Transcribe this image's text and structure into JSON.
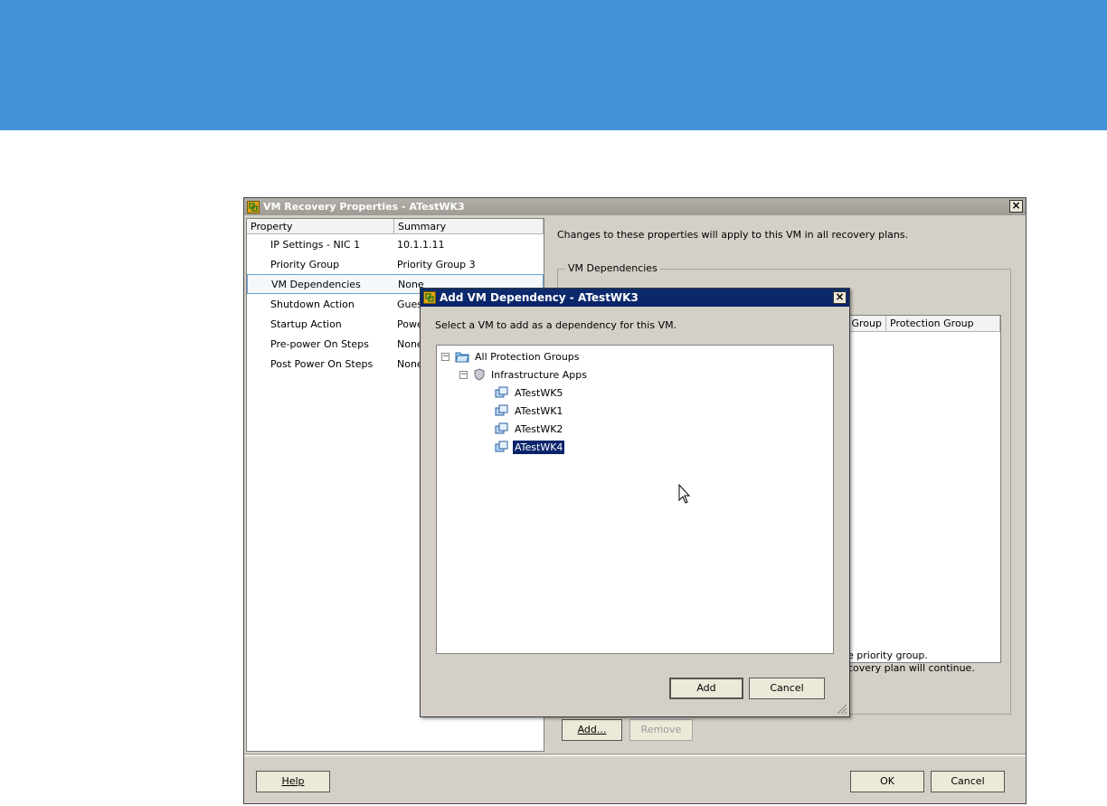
{
  "main_window": {
    "title": "VM Recovery Properties - ATestWK3",
    "columns": {
      "property": "Property",
      "summary": "Summary"
    },
    "properties": [
      {
        "name": "IP Settings - NIC 1",
        "summary": "10.1.1.11"
      },
      {
        "name": "Priority Group",
        "summary": "Priority Group 3"
      },
      {
        "name": "VM Dependencies",
        "summary": "None"
      },
      {
        "name": "Shutdown Action",
        "summary": "Gues"
      },
      {
        "name": "Startup Action",
        "summary": "Powe"
      },
      {
        "name": "Pre-power On Steps",
        "summary": "None"
      },
      {
        "name": "Post Power On Steps",
        "summary": "None"
      }
    ],
    "selected_property": "VM Dependencies",
    "info_text": "Changes to these properties will apply to this VM in all recovery plans.",
    "dependencies_group": {
      "legend": "VM Dependencies",
      "list_columns": [
        "Group",
        "Protection Group"
      ],
      "note_line1": "e priority group.",
      "note_line2": "covery plan will continue."
    },
    "add_button": "Add...",
    "remove_button": "Remove",
    "help_button": "Help",
    "ok_button": "OK",
    "cancel_button": "Cancel"
  },
  "add_dialog": {
    "title": "Add VM Dependency - ATestWK3",
    "instruction": "Select a VM to add as a dependency for this VM.",
    "tree": {
      "root": "All Protection Groups",
      "group": "Infrastructure Apps",
      "vms": [
        "ATestWK5",
        "ATestWK1",
        "ATestWK2",
        "ATestWK4"
      ],
      "selected": "ATestWK4"
    },
    "add_button": "Add",
    "cancel_button": "Cancel"
  },
  "colors": {
    "banner": "#4192d6",
    "selection": "#0a246a",
    "dialog_face": "#d4d0c8"
  }
}
